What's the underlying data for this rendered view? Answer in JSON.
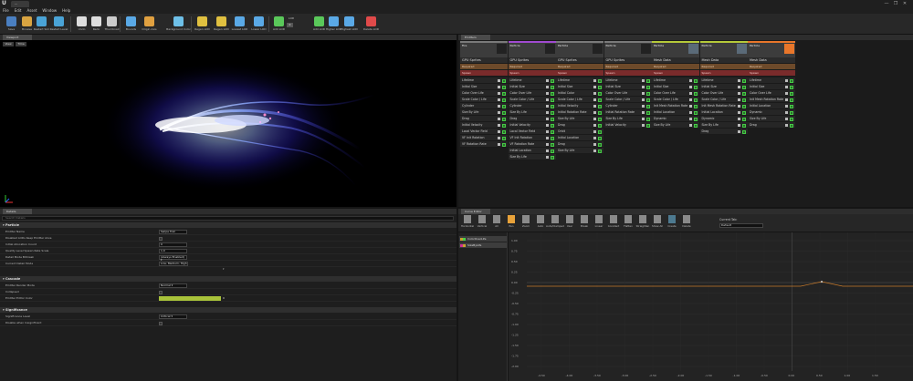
{
  "window": {
    "doc_tab": "...",
    "controls": [
      "—",
      "❐",
      "✕"
    ]
  },
  "menu": [
    "File",
    "Edit",
    "Asset",
    "Window",
    "Help"
  ],
  "toolbar": {
    "buttons": [
      {
        "label": "Save",
        "icon": "save-icon",
        "color": "#4a7fc1"
      },
      {
        "label": "Browse",
        "icon": "browse-icon",
        "color": "#d9a441"
      },
      {
        "label": "Restart Sim",
        "icon": "restart-sim-icon",
        "color": "#4aa3d6"
      },
      {
        "label": "Restart Level",
        "icon": "restart-level-icon",
        "color": "#4aa3d6"
      },
      {
        "label": "Undo",
        "icon": "undo-icon",
        "color": "#dddddd"
      },
      {
        "label": "Redo",
        "icon": "redo-icon",
        "color": "#dddddd"
      },
      {
        "label": "Thumbnail",
        "icon": "thumbnail-icon",
        "color": "#cccccc"
      },
      {
        "label": "Bounds",
        "icon": "bounds-icon",
        "color": "#5aa9e6"
      },
      {
        "label": "Origin Axis",
        "icon": "origin-axis-icon",
        "color": "#e0a040"
      },
      {
        "label": "Background Color",
        "icon": "background-color-icon",
        "color": "#6ec0e8"
      },
      {
        "label": "Regen LOD",
        "icon": "regen-lod-icon",
        "color": "#e0c040"
      },
      {
        "label": "Regen LOD",
        "icon": "regen-lod-2-icon",
        "color": "#e0c040"
      },
      {
        "label": "Lowest LOD",
        "icon": "lowest-lod-icon",
        "color": "#5aa9e6"
      },
      {
        "label": "Lower LOD",
        "icon": "lower-lod-icon",
        "color": "#5aa9e6"
      },
      {
        "label": "Add LOD",
        "icon": "add-lod-icon",
        "color": "#5ac85a"
      },
      {
        "label": "Add LOD",
        "icon": "add-lod-2-icon",
        "color": "#5ac85a"
      },
      {
        "label": "Higher LOD",
        "icon": "higher-lod-icon",
        "color": "#5aa9e6"
      },
      {
        "label": "Highest LOD",
        "icon": "highest-lod-icon",
        "color": "#5aa9e6"
      },
      {
        "label": "Delete LOD",
        "icon": "delete-lod-icon",
        "color": "#e04a4a"
      }
    ],
    "lod_label": "LOD",
    "lod_value": "0"
  },
  "viewport": {
    "tab": "Viewport",
    "view_button": "View",
    "time_button": "Time"
  },
  "emitters": {
    "tab": "Emitters",
    "columns": [
      {
        "name": "Fire",
        "accent": "#7a7a7a",
        "type": "GPU Sprites",
        "required": "Required",
        "spawn": "Spawn",
        "modules": [
          "Lifetime",
          "Initial Size",
          "Color Over Life",
          "Scale Color / Life",
          "Cylinder",
          "Size By Life",
          "Drag",
          "Initial Velocity",
          "Local Vector Field",
          "VF Init Rotation",
          "VF Rotation Rate"
        ]
      },
      {
        "name": "Particle",
        "accent": "#a04ad0",
        "type": "GPU Sprites",
        "required": "Required",
        "spawn": "Spawn",
        "modules": [
          "Lifetime",
          "Initial Size",
          "Color Over Life",
          "Scale Color / Life",
          "Cylinder",
          "Size By Life",
          "Drag",
          "Initial Velocity",
          "Local Vector Field",
          "VF Init Rotation",
          "VF Rotation Rate",
          "Initial Location",
          "Size By Life"
        ]
      },
      {
        "name": "Particle",
        "accent": "#7a7a7a",
        "type": "GPU Sprites",
        "required": "Required",
        "spawn": "Spawn",
        "modules": [
          "Lifetime",
          "Initial Size",
          "Initial Color",
          "Scale Color / Life",
          "Initial Velocity",
          "Initial Rotation Rate",
          "Size By Life",
          "Drag",
          "Orbit",
          "Initial Location",
          "Drag",
          "Size By Life"
        ]
      },
      {
        "name": "Particle",
        "accent": "#7a7a7a",
        "type": "GPU Sprites",
        "required": "Required",
        "spawn": "Spawn",
        "modules": [
          "Lifetime",
          "Initial Size",
          "Color Over Life",
          "Scale Color / Life",
          "Cylinder",
          "Initial Rotation Rate",
          "Size By Life",
          "Initial Velocity"
        ]
      },
      {
        "name": "Particle",
        "accent": "#b5c93a",
        "type": "Mesh Data",
        "required": "Required",
        "spawn": "Spawn",
        "modules": [
          "Lifetime",
          "Initial Size",
          "Color Over Life",
          "Scale Color / Life",
          "Init Mesh Rotation Rate",
          "Initial Location",
          "Dynamic",
          "Size By Life"
        ]
      },
      {
        "name": "Particle",
        "accent": "#b5c93a",
        "type": "Mesh Data",
        "required": "Required",
        "spawn": "Spawn",
        "modules": [
          "Lifetime",
          "Initial Size",
          "Color Over Life",
          "Scale Color / Life",
          "Init Mesh Rotation Rate",
          "Initial Location",
          "Dynamic",
          "Size By Life",
          "Drag"
        ]
      },
      {
        "name": "Particle",
        "accent": "#e8762a",
        "type": "Mesh Data",
        "required": "Required",
        "spawn": "Spawn",
        "modules": [
          "Lifetime",
          "Initial Size",
          "Color Over Life",
          "Init Mesh Rotation Rate",
          "Initial Location",
          "Dynamic",
          "Size By Life",
          "Drag"
        ]
      }
    ]
  },
  "details": {
    "tab": "Details",
    "search_placeholder": "Search Details",
    "sections": [
      {
        "title": "Particle",
        "rows": [
          {
            "label": "Emitter Name",
            "type": "text",
            "value": "Swipe Trail"
          },
          {
            "label": "Disabled LODs Keep Emitter Alive",
            "type": "check"
          },
          {
            "label": "Initial Allocation Count",
            "type": "num",
            "value": "0"
          },
          {
            "label": "Quality Level Spawn Rate Scale",
            "type": "num",
            "value": "1.0"
          },
          {
            "label": "Detail Mode Bitmask",
            "type": "combo",
            "value": "(Always Enabled)"
          },
          {
            "label": "Current Detail Mode",
            "type": "text",
            "value": "Low, Medium, High"
          }
        ]
      },
      {
        "title": "Cascade",
        "rows": [
          {
            "label": "Emitter Render Mode",
            "type": "combo",
            "value": "Normal"
          },
          {
            "label": "Collapsed",
            "type": "check"
          },
          {
            "label": "Emitter Editor Color",
            "type": "color",
            "value": "R"
          }
        ]
      },
      {
        "title": "Significance",
        "rows": [
          {
            "label": "Significance Level",
            "type": "combo",
            "value": "Critical"
          },
          {
            "label": "Disable when Insignificant",
            "type": "check"
          }
        ]
      }
    ]
  },
  "curve_editor": {
    "tab": "Curve Editor",
    "buttons": [
      "Horizontal",
      "Vertical",
      "All",
      "Pan",
      "Zoom",
      "Auto",
      "Auto/Clamped",
      "User",
      "Break",
      "Linear",
      "Constant",
      "Flatten",
      "Straighten",
      "Show All",
      "Create",
      "Delete"
    ],
    "current_tab_label": "Current Tab:",
    "current_tab_value": "Default",
    "entries": [
      {
        "name": "ColorOverLife",
        "swatch": "#c8a030",
        "swatch2": "#4ad04a"
      },
      {
        "name": "SizeByLife",
        "swatch": "#d03090",
        "swatch2": "#c8a030"
      }
    ],
    "y_ticks": [
      "1.00",
      "0.75",
      "0.50",
      "0.25",
      "0.00",
      "-0.25",
      "-0.50",
      "-0.75",
      "-1.00",
      "-1.25",
      "-1.50",
      "-1.75",
      "-2.00"
    ],
    "x_ticks": [
      "-4.50",
      "-4.00",
      "-3.50",
      "-3.00",
      "-2.50",
      "-2.00",
      "-1.50",
      "-1.00",
      "-0.50",
      "0.00",
      "0.50",
      "1.00",
      "1.50"
    ]
  }
}
